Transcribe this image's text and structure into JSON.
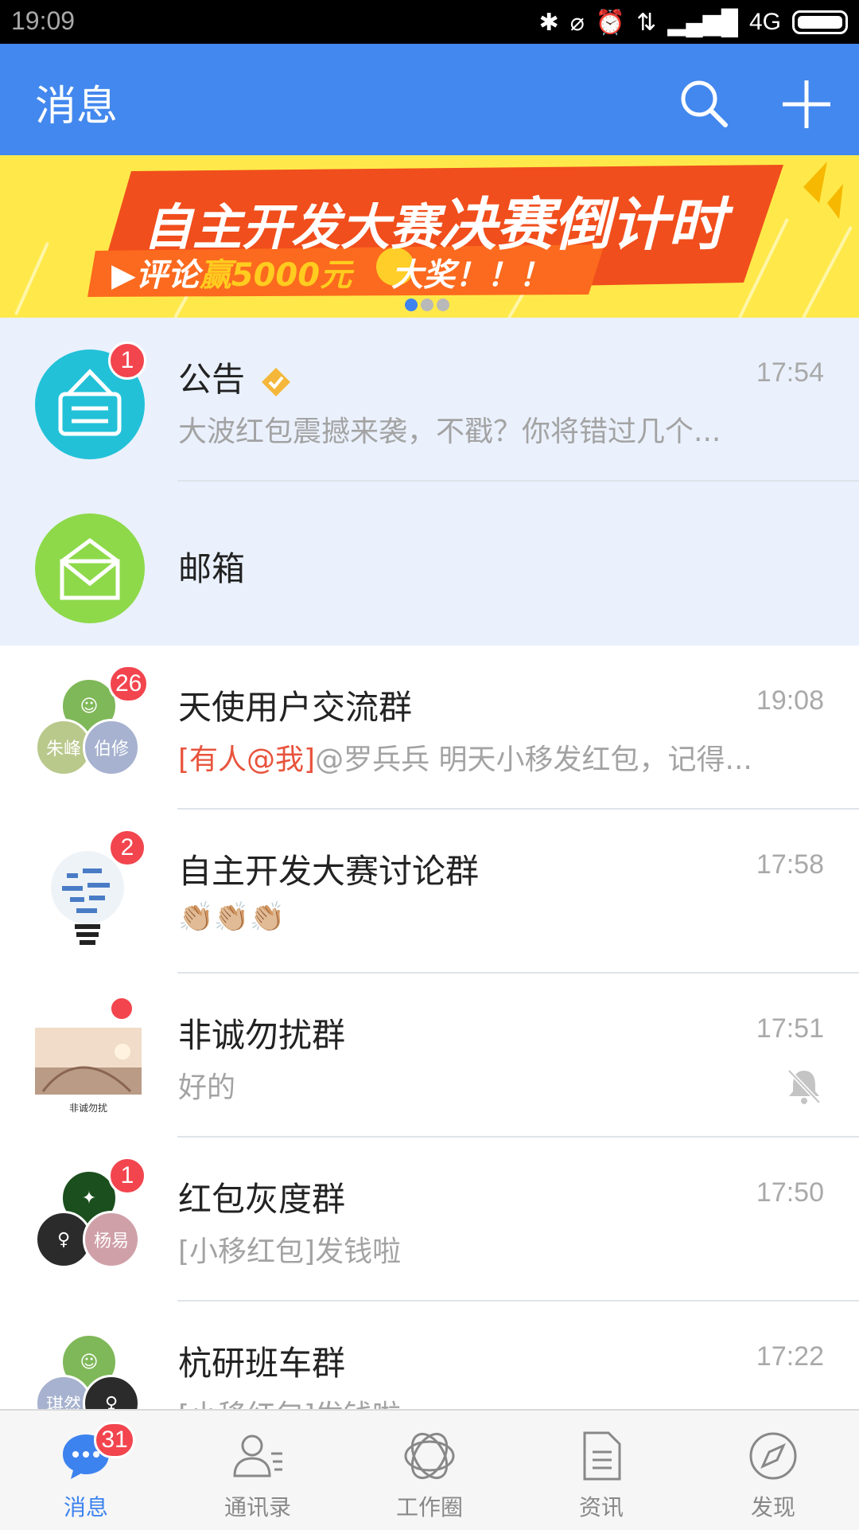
{
  "status_bar": {
    "time": "19:09",
    "network": "4G"
  },
  "app_bar": {
    "title": "消息"
  },
  "banner": {
    "line1_prefix": "自主开发大赛",
    "line1_emphasis": "决赛倒计时",
    "line2_prefix": "▶评论",
    "line2_gold": "赢5000元",
    "line2_suffix": "大奖！！！"
  },
  "conversations": [
    {
      "name": "公告",
      "time": "17:54",
      "preview": "大波红包震撼来袭，不戳？你将错过几个...",
      "badge": "1"
    },
    {
      "name": "邮箱"
    },
    {
      "name": "天使用户交流群",
      "time": "19:08",
      "mention": "[有人@我]",
      "preview": "@罗兵兵 明天小移发红包，记得...",
      "badge": "26",
      "member_labels": [
        "朱峰",
        "伯修"
      ]
    },
    {
      "name": "自主开发大赛讨论群",
      "time": "17:58",
      "preview": "👏🏼👏🏼👏🏼",
      "badge": "2"
    },
    {
      "name": "非诚勿扰群",
      "time": "17:51",
      "preview": "好的",
      "avatar_caption": "非诚勿扰",
      "muted": true
    },
    {
      "name": "红包灰度群",
      "time": "17:50",
      "preview": "[小移红包]发钱啦",
      "badge": "1",
      "member_labels": [
        "杨易"
      ]
    },
    {
      "name": "杭研班车群",
      "time": "17:22",
      "preview": "[小移红包]发钱啦",
      "member_labels": [
        "琪然"
      ]
    }
  ],
  "tab_bar": {
    "tabs": [
      {
        "label": "消息",
        "badge": "31",
        "active": true
      },
      {
        "label": "通讯录"
      },
      {
        "label": "工作圈"
      },
      {
        "label": "资讯"
      },
      {
        "label": "发现"
      }
    ]
  },
  "colors": {
    "primary": "#4388ee",
    "badge": "#f2454e",
    "pinned_bg": "#eaf1fd"
  }
}
